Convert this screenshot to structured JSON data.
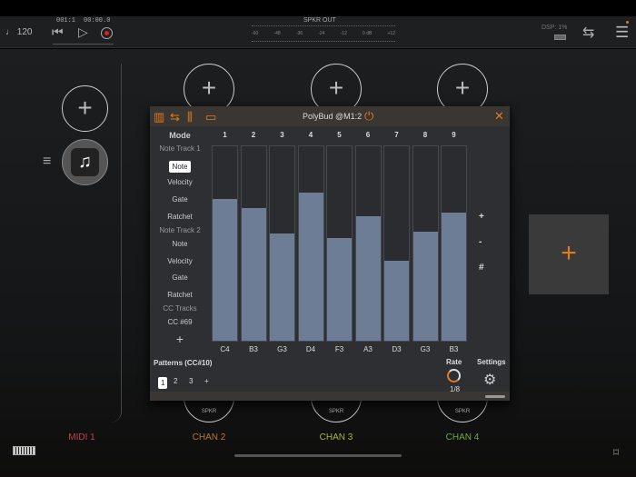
{
  "transport": {
    "tempo": "♩ 120",
    "position": "001:1",
    "time": "00:00.0"
  },
  "meter": {
    "title": "SPKR OUT",
    "scale": [
      "-60",
      "-48",
      "-36",
      "-24",
      "-12",
      "0 dB",
      "+12"
    ]
  },
  "dsp": "DSP: 1%",
  "plugin": {
    "title": "PolyBud @M1:2",
    "mode_label": "Mode",
    "modes": [
      {
        "text": "Note Track 1",
        "type": "header"
      },
      {
        "text": "Note",
        "type": "selected"
      },
      {
        "text": "Velocity",
        "type": "item"
      },
      {
        "text": "Gate",
        "type": "item"
      },
      {
        "text": "Ratchet",
        "type": "item"
      },
      {
        "text": "Note Track 2",
        "type": "header"
      },
      {
        "text": "Note",
        "type": "item"
      },
      {
        "text": "Velocity",
        "type": "item"
      },
      {
        "text": "Gate",
        "type": "item"
      },
      {
        "text": "Ratchet",
        "type": "item"
      },
      {
        "text": "CC Tracks",
        "type": "header"
      },
      {
        "text": "CC #69",
        "type": "item"
      }
    ],
    "add_label": "+",
    "steps": [
      {
        "num": "1",
        "note": "C4",
        "value": 0.73
      },
      {
        "num": "2",
        "note": "B3",
        "value": 0.68
      },
      {
        "num": "3",
        "note": "G3",
        "value": 0.55
      },
      {
        "num": "4",
        "note": "D4",
        "value": 0.76
      },
      {
        "num": "5",
        "note": "F3",
        "value": 0.53
      },
      {
        "num": "6",
        "note": "A3",
        "value": 0.64
      },
      {
        "num": "7",
        "note": "D3",
        "value": 0.41
      },
      {
        "num": "8",
        "note": "G3",
        "value": 0.56
      },
      {
        "num": "9",
        "note": "B3",
        "value": 0.66
      }
    ],
    "side_buttons": [
      "+",
      "-",
      "#"
    ],
    "patterns_label": "Patterns (CC#10)",
    "patterns": [
      "1",
      "2",
      "3",
      "+"
    ],
    "rate_label": "Rate",
    "rate_value": "1/8",
    "settings_label": "Settings"
  },
  "channels": [
    {
      "label": "MIDI 1",
      "color": "#c0444a"
    },
    {
      "label": "CHAN 2",
      "color": "#b8743a"
    },
    {
      "label": "CHAN 3",
      "color": "#a8b43a"
    },
    {
      "label": "CHAN 4",
      "color": "#6aaa3a"
    }
  ],
  "spkr": "SPKR"
}
